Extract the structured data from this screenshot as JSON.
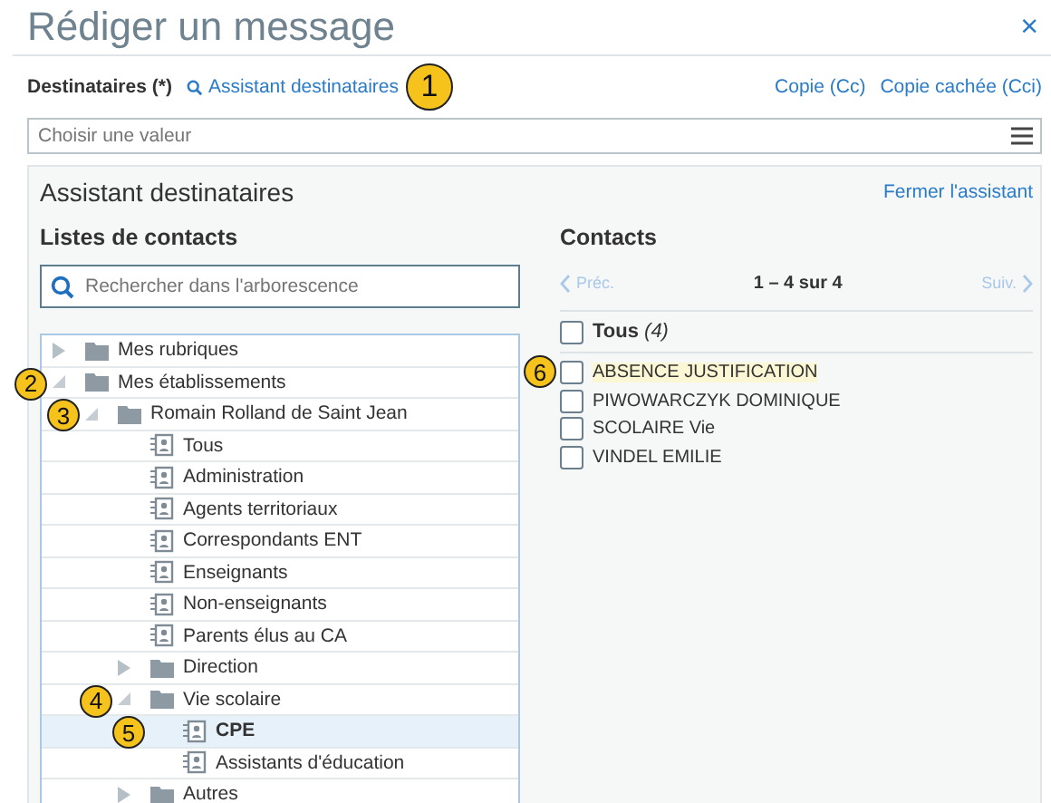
{
  "dialog": {
    "title": "Rédiger un message",
    "close": "×"
  },
  "recipients": {
    "label": "Destinataires (*)",
    "assistant_link": "Assistant destinataires",
    "callout": "1",
    "cc_link": "Copie (Cc)",
    "bcc_link": "Copie cachée (Cci)",
    "field": {
      "placeholder": "Choisir une valeur"
    }
  },
  "assistant": {
    "title": "Assistant destinataires",
    "close_link": "Fermer l'assistant",
    "lists": {
      "heading": "Listes de contacts",
      "search": {
        "placeholder": "Rechercher dans l'arborescence"
      },
      "tree": [
        {
          "kind": "folder",
          "label": "Mes rubriques",
          "expanded": false,
          "selected": false
        },
        {
          "kind": "folder",
          "label": "Mes établissements",
          "expanded": true,
          "selected": false,
          "callout": "2",
          "children": [
            {
              "kind": "folder",
              "label": "Romain Rolland de Saint Jean",
              "expanded": true,
              "selected": false,
              "callout": "3",
              "children": [
                {
                  "kind": "list",
                  "label": "Tous",
                  "selected": false
                },
                {
                  "kind": "list",
                  "label": "Administration",
                  "selected": false
                },
                {
                  "kind": "list",
                  "label": "Agents territoriaux",
                  "selected": false
                },
                {
                  "kind": "list",
                  "label": "Correspondants ENT",
                  "selected": false
                },
                {
                  "kind": "list",
                  "label": "Enseignants",
                  "selected": false
                },
                {
                  "kind": "list",
                  "label": "Non-enseignants",
                  "selected": false
                },
                {
                  "kind": "list",
                  "label": "Parents élus au CA",
                  "selected": false
                },
                {
                  "kind": "folder",
                  "label": "Direction",
                  "expanded": false,
                  "selected": false
                },
                {
                  "kind": "folder",
                  "label": "Vie scolaire",
                  "expanded": true,
                  "selected": false,
                  "callout": "4",
                  "children": [
                    {
                      "kind": "list",
                      "label": "CPE",
                      "selected": true,
                      "callout": "5"
                    },
                    {
                      "kind": "list",
                      "label": "Assistants d'éducation",
                      "selected": false
                    }
                  ]
                },
                {
                  "kind": "folder",
                  "label": "Autres",
                  "expanded": false,
                  "selected": false
                }
              ]
            }
          ]
        }
      ]
    },
    "contacts": {
      "heading": "Contacts",
      "prev": "Préc.",
      "next": "Suiv.",
      "range": "1 – 4 sur 4",
      "all_label": "Tous",
      "all_count": "(4)",
      "all_checked": false,
      "items": [
        {
          "name": "ABSENCE JUSTIFICATION",
          "checked": false,
          "highlighted": true,
          "callout": "6"
        },
        {
          "name": "PIWOWARCZYK DOMINIQUE",
          "checked": false,
          "highlighted": false
        },
        {
          "name": "SCOLAIRE Vie",
          "checked": false,
          "highlighted": false
        },
        {
          "name": "VINDEL EMILIE",
          "checked": false,
          "highlighted": false
        }
      ]
    }
  }
}
